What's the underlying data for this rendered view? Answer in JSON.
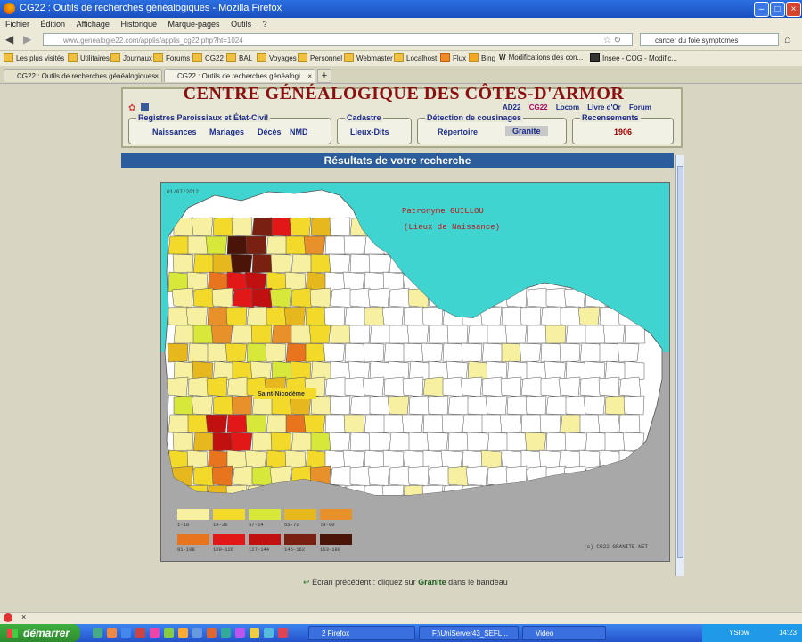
{
  "window": {
    "title": "CG22 : Outils de recherches généalogiques - Mozilla Firefox"
  },
  "menu": [
    "Fichier",
    "Édition",
    "Affichage",
    "Historique",
    "Marque-pages",
    "Outils",
    "?"
  ],
  "nav": {
    "url": "www.genealogie22.com/applis/applis_cg22.php?ht=1024",
    "search": "cancer du foie symptomes"
  },
  "bookmarks": [
    "Les plus visités",
    "Utilitaires",
    "Journaux",
    "Forums",
    "CG22",
    "BAL",
    "Voyages",
    "Personnel",
    "Webmaster",
    "Localhost",
    "Flux",
    "Bing",
    "Modifications des con...",
    "Insee - COG - Modific..."
  ],
  "tabs": [
    {
      "label": "CG22 : Outils de recherches généalogiques"
    },
    {
      "label": "CG22 : Outils de recherches généalogi..."
    }
  ],
  "site": {
    "title": "CENTRE GÉNÉALOGIQUE DES CÔTES-D'ARMOR",
    "top_links": [
      "AD22",
      "CG22",
      "Locom",
      "Livre d'Or",
      "Forum"
    ],
    "registres": {
      "legend": "Registres Paroissiaux et État-Civil",
      "links": [
        "Naissances",
        "Mariages",
        "Décès",
        "NMD"
      ]
    },
    "cadastre": {
      "legend": "Cadastre",
      "link": "Lieux-Dits"
    },
    "cousinages": {
      "legend": "Détection de cousinages",
      "repertoire": "Répertoire",
      "granite": "Granite"
    },
    "recensements": {
      "legend": "Recensements",
      "year": "1906"
    },
    "results_title": "Résultats de votre recherche"
  },
  "map": {
    "date": "01/07/2012",
    "patronyme": "Patronyme GUILLOU",
    "subtitle": "(Lieux de Naissance)",
    "town_label": "Saint-Nicodème",
    "copyright": "(c) CG22 GRANITE-NET",
    "sea_color": "#3fd4cf",
    "land_color": "#a8a8a8",
    "legend": [
      {
        "range": "1-18",
        "color": "#f7f0a0"
      },
      {
        "range": "19-36",
        "color": "#f2d92a"
      },
      {
        "range": "37-54",
        "color": "#d8e83a"
      },
      {
        "range": "55-72",
        "color": "#e6b81e"
      },
      {
        "range": "73-90",
        "color": "#e8902a"
      },
      {
        "range": "91-108",
        "color": "#e8741e"
      },
      {
        "range": "109-126",
        "color": "#e21818"
      },
      {
        "range": "127-144",
        "color": "#c01010"
      },
      {
        "range": "145-162",
        "color": "#7a2010"
      },
      {
        "range": "163-180",
        "color": "#4a1408"
      }
    ]
  },
  "footer": {
    "prefix": "Écran précédent : cliquez sur ",
    "link": "Granite",
    "suffix": " dans le bandeau"
  },
  "taskbar": {
    "start": "démarrer",
    "tasks": [
      "2 Firefox",
      "F:\\UniServer43_SEFL...",
      "Video"
    ],
    "tray_label": "YSlow",
    "clock": "14:23"
  }
}
